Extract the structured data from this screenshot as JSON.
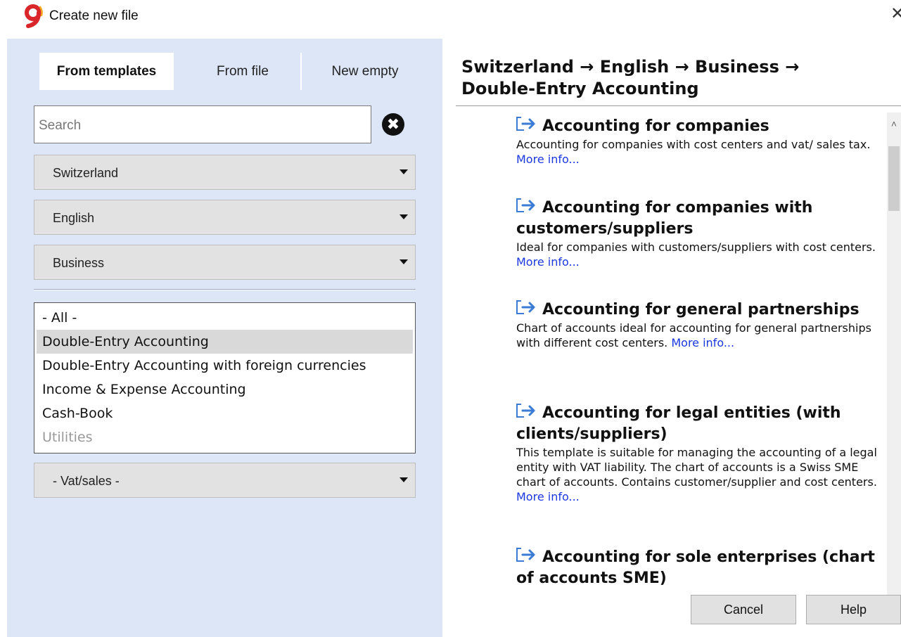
{
  "window": {
    "title": "Create new file",
    "close_glyph": "✕"
  },
  "tabs": [
    {
      "label": "From templates",
      "selected": true
    },
    {
      "label": "From file",
      "selected": false
    },
    {
      "label": "New empty",
      "selected": false
    }
  ],
  "search": {
    "placeholder": "Search",
    "value": "",
    "clear_icon": "✖"
  },
  "filters": {
    "country": "Switzerland",
    "language": "English",
    "category": "Business",
    "vat": "- Vat/sales -"
  },
  "accounting_types": [
    {
      "label": "- All -",
      "state": "normal"
    },
    {
      "label": "Double-Entry Accounting",
      "state": "selected"
    },
    {
      "label": "Double-Entry Accounting with foreign currencies",
      "state": "normal"
    },
    {
      "label": "Income & Expense Accounting",
      "state": "normal"
    },
    {
      "label": "Cash-Book",
      "state": "normal"
    },
    {
      "label": "Utilities",
      "state": "disabled"
    }
  ],
  "breadcrumb_title": "Switzerland → English → Business → Double-Entry Accounting",
  "templates": [
    {
      "title": "Accounting for companies",
      "desc": "Accounting for companies with cost centers and vat/ sales tax. ",
      "link": "More info..."
    },
    {
      "title": "Accounting for companies with customers/suppliers",
      "desc": "Ideal for companies with customers/suppliers with cost centers. ",
      "link": "More info..."
    },
    {
      "title": "Accounting for general partnerships",
      "desc": "Chart of accounts ideal for accounting for general partnerships with different cost centers. ",
      "link": "More info..."
    },
    {
      "title": "Accounting for legal entities (with clients/suppliers)",
      "desc": "This template is suitable for managing the accounting of a legal entity with VAT liability. The chart of accounts is a Swiss SME chart of accounts. Contains customer/supplier and cost centers. ",
      "link": "More info..."
    },
    {
      "title": "Accounting for sole enterprises (chart of accounts SME)",
      "desc": "",
      "link": ""
    }
  ],
  "buttons": {
    "cancel": "Cancel",
    "help": "Help"
  },
  "colors": {
    "panel_bg": "#dce6f7",
    "link": "#1a37e0",
    "logo_red": "#d9262b",
    "logo_yellow": "#f5a623"
  }
}
